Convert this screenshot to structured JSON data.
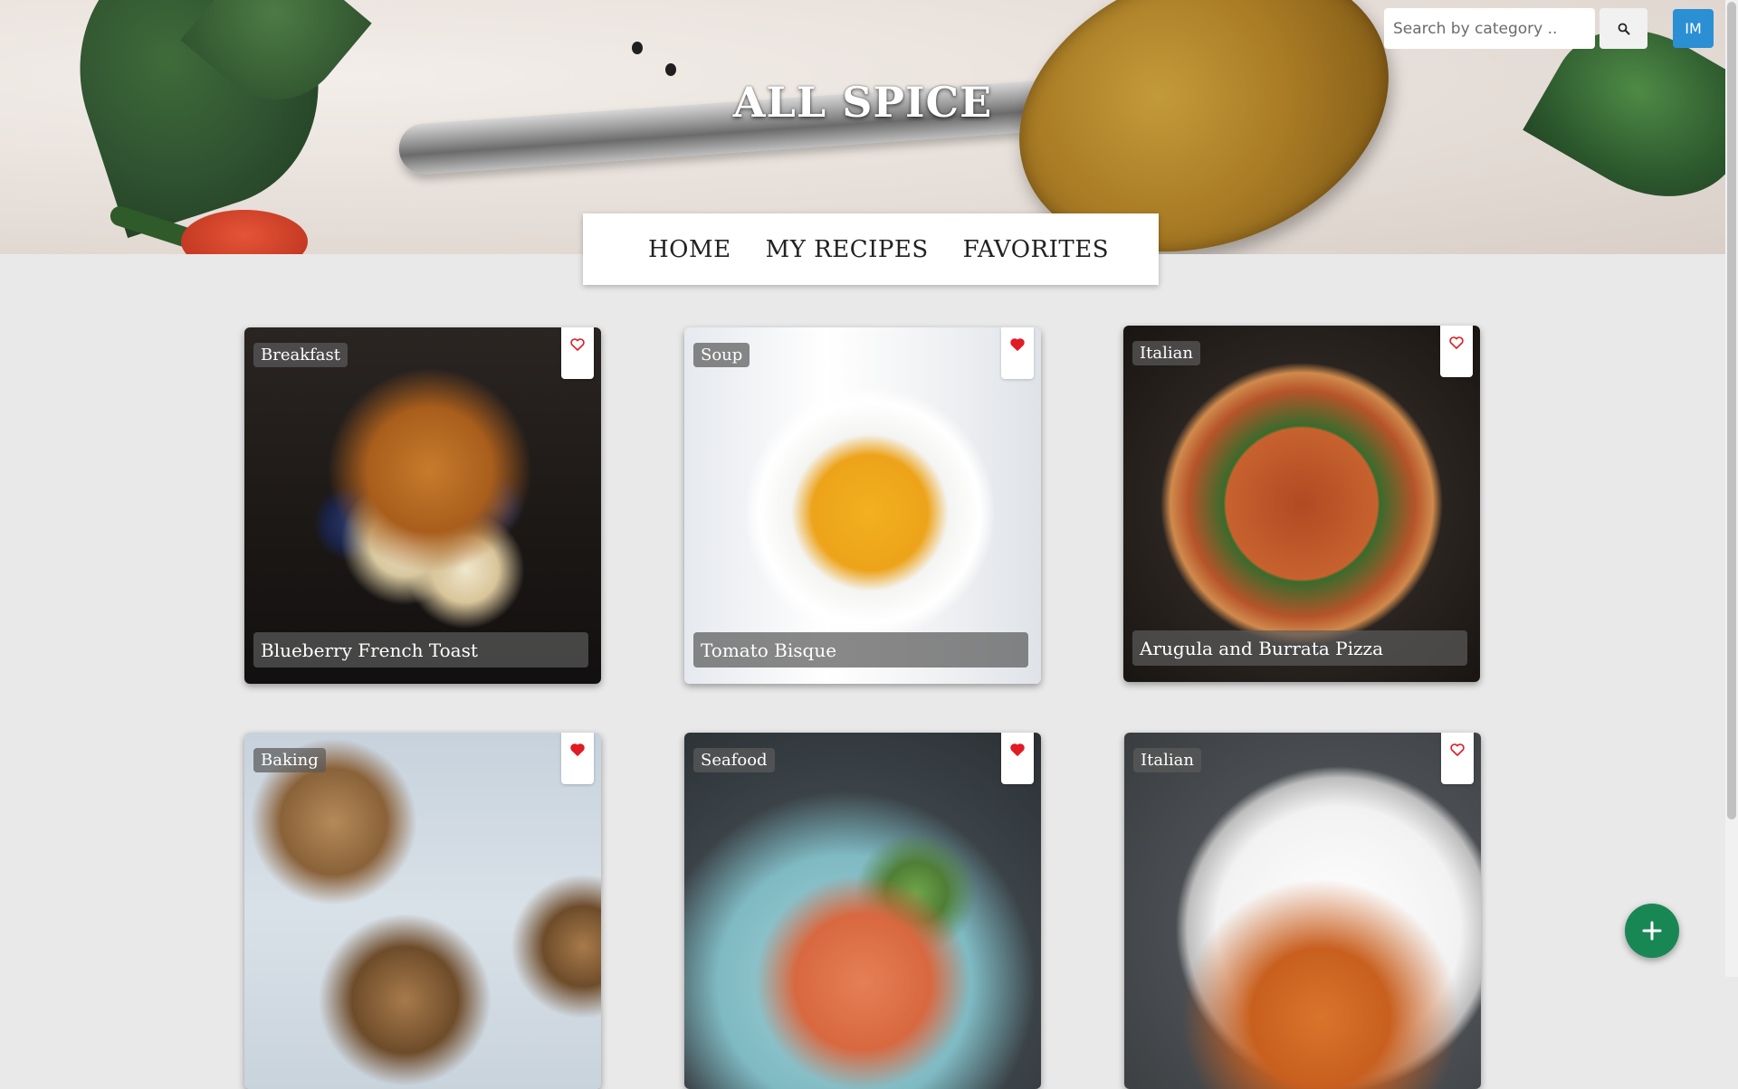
{
  "site": {
    "title": "ALL SPICE"
  },
  "search": {
    "placeholder": "Search by category ..",
    "button_icon": "search-icon"
  },
  "user": {
    "initials": "IM",
    "avatar_color": "#2b8fd4"
  },
  "nav": {
    "items": [
      {
        "label": "HOME"
      },
      {
        "label": "MY RECIPES"
      },
      {
        "label": "FAVORITES"
      }
    ]
  },
  "recipes": [
    {
      "title": "Blueberry French Toast",
      "category": "Breakfast",
      "favorited": false
    },
    {
      "title": "Tomato Bisque",
      "category": "Soup",
      "favorited": true
    },
    {
      "title": "Arugula and Burrata Pizza",
      "category": "Italian",
      "favorited": false
    },
    {
      "title": "",
      "category": "Baking",
      "favorited": true
    },
    {
      "title": "",
      "category": "Seafood",
      "favorited": true
    },
    {
      "title": "",
      "category": "Italian",
      "favorited": false
    }
  ],
  "fab": {
    "icon": "plus-icon",
    "color": "#198754"
  },
  "colors": {
    "heart": "#e01b24",
    "page_background": "#e9e9e9"
  }
}
